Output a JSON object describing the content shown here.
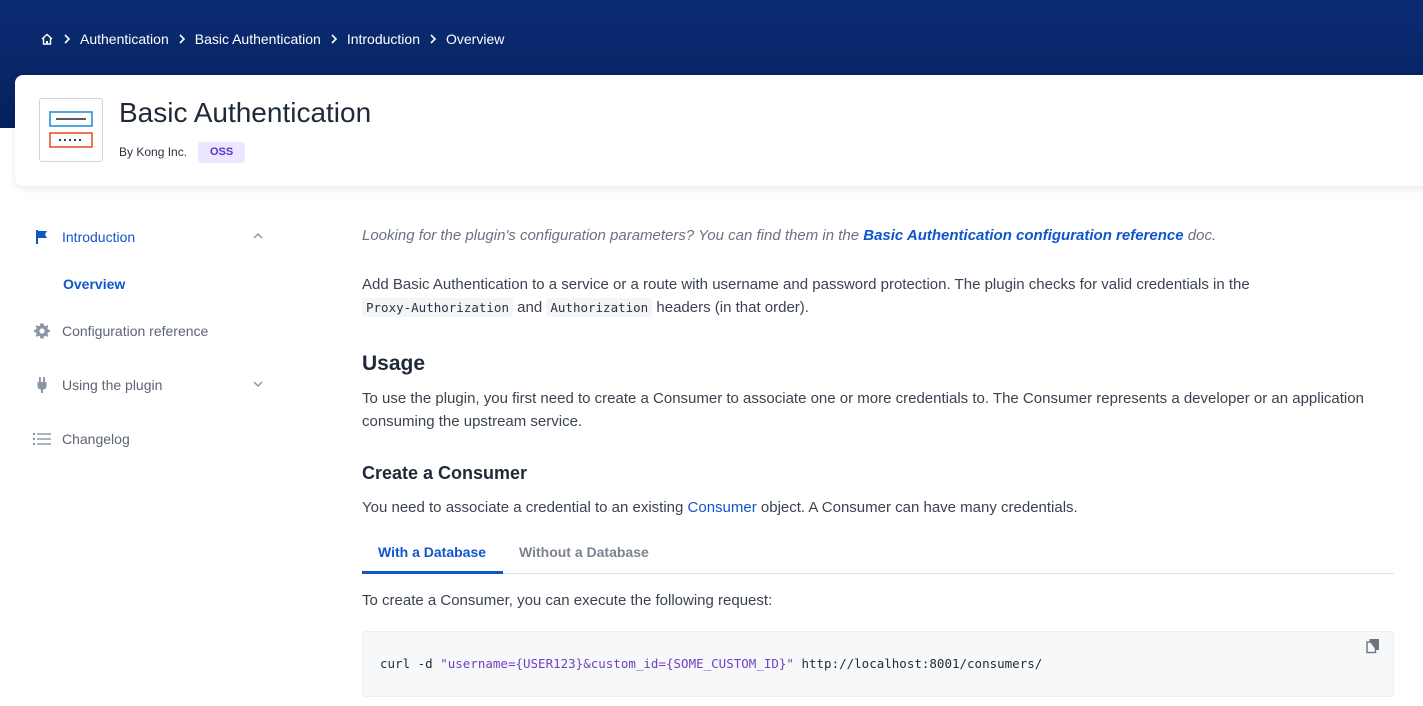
{
  "breadcrumb": {
    "items": [
      "Authentication",
      "Basic Authentication",
      "Introduction",
      "Overview"
    ]
  },
  "plugin": {
    "title": "Basic Authentication",
    "byline": "By Kong Inc.",
    "badge": "OSS"
  },
  "sidebar": {
    "introduction": "Introduction",
    "overview": "Overview",
    "configuration_reference": "Configuration reference",
    "using_the_plugin": "Using the plugin",
    "changelog": "Changelog"
  },
  "content": {
    "note_prefix": "Looking for the plugin's configuration parameters? You can find them in the ",
    "note_link": "Basic Authentication configuration reference",
    "note_suffix": " doc.",
    "intro_prefix": "Add Basic Authentication to a service or a route with username and password protection. The plugin checks for valid credentials in the",
    "intro_code1": "Proxy-Authorization",
    "intro_and": " and ",
    "intro_code2": "Authorization",
    "intro_suffix": " headers (in that order).",
    "usage_heading": "Usage",
    "usage_text": "To use the plugin, you first need to create a Consumer to associate one or more credentials to. The Consumer represents a developer or an application consuming the upstream service.",
    "create_heading": "Create a Consumer",
    "create_prefix": "You need to associate a credential to an existing ",
    "create_link": "Consumer",
    "create_suffix": " object. A Consumer can have many credentials.",
    "tab_with_db": "With a Database",
    "tab_without_db": "Without a Database",
    "request_text": "To create a Consumer, you can execute the following request:",
    "code_cmd": "curl -d ",
    "code_string": "\"username={USER123}&custom_id={SOME_CUSTOM_ID}\"",
    "code_url": " http://localhost:8001/consumers/"
  },
  "colors": {
    "header_bg": "#0b2b73",
    "accent": "#1155cb",
    "badge_bg": "#ece7ff",
    "badge_text": "#5b30c9"
  }
}
